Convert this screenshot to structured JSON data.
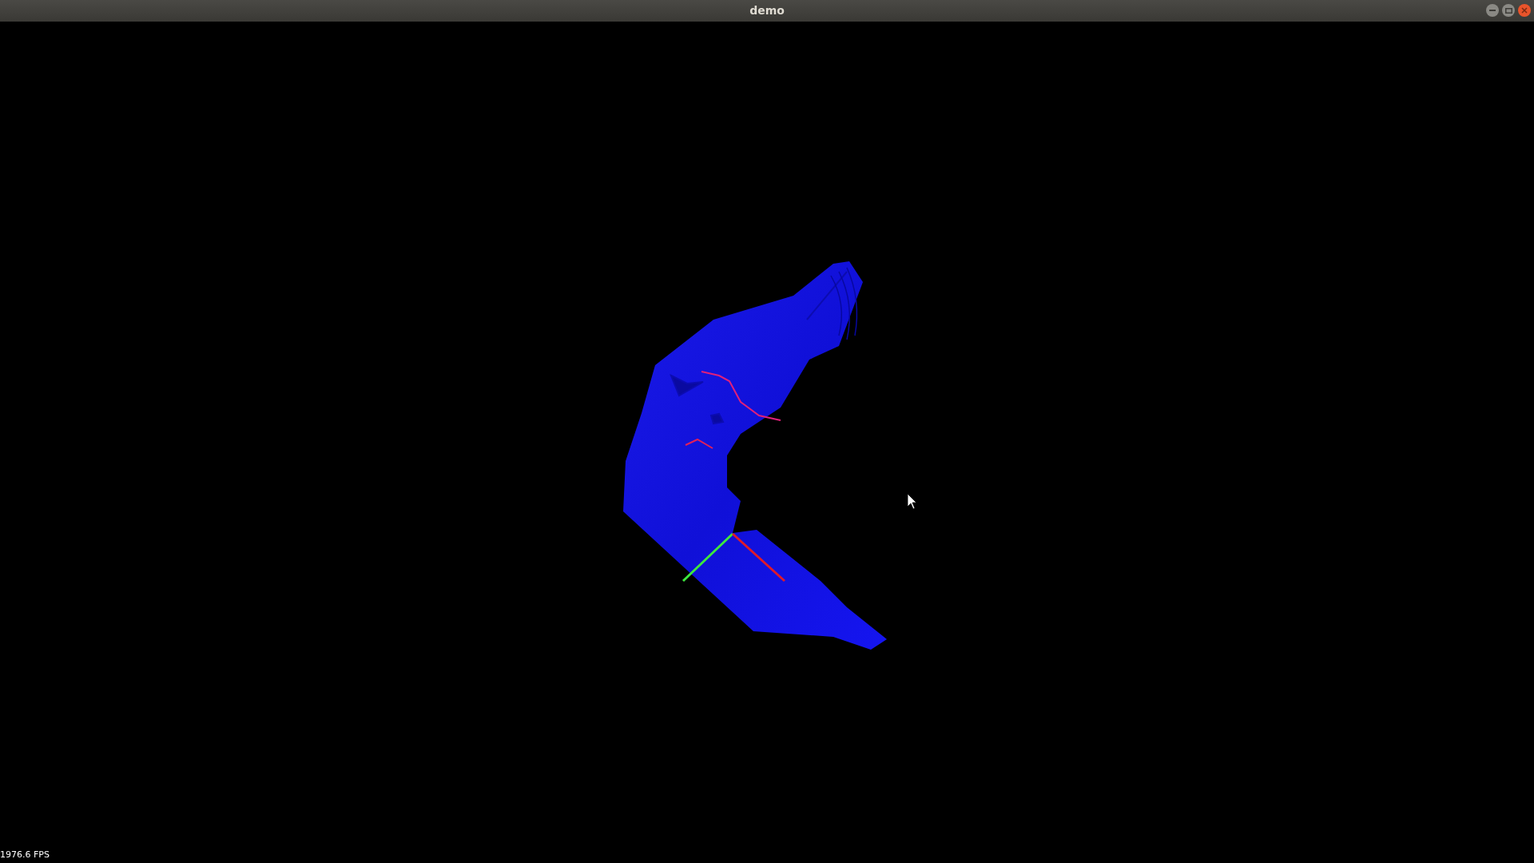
{
  "window": {
    "title": "demo"
  },
  "overlay": {
    "fps": "1976.6 FPS"
  }
}
